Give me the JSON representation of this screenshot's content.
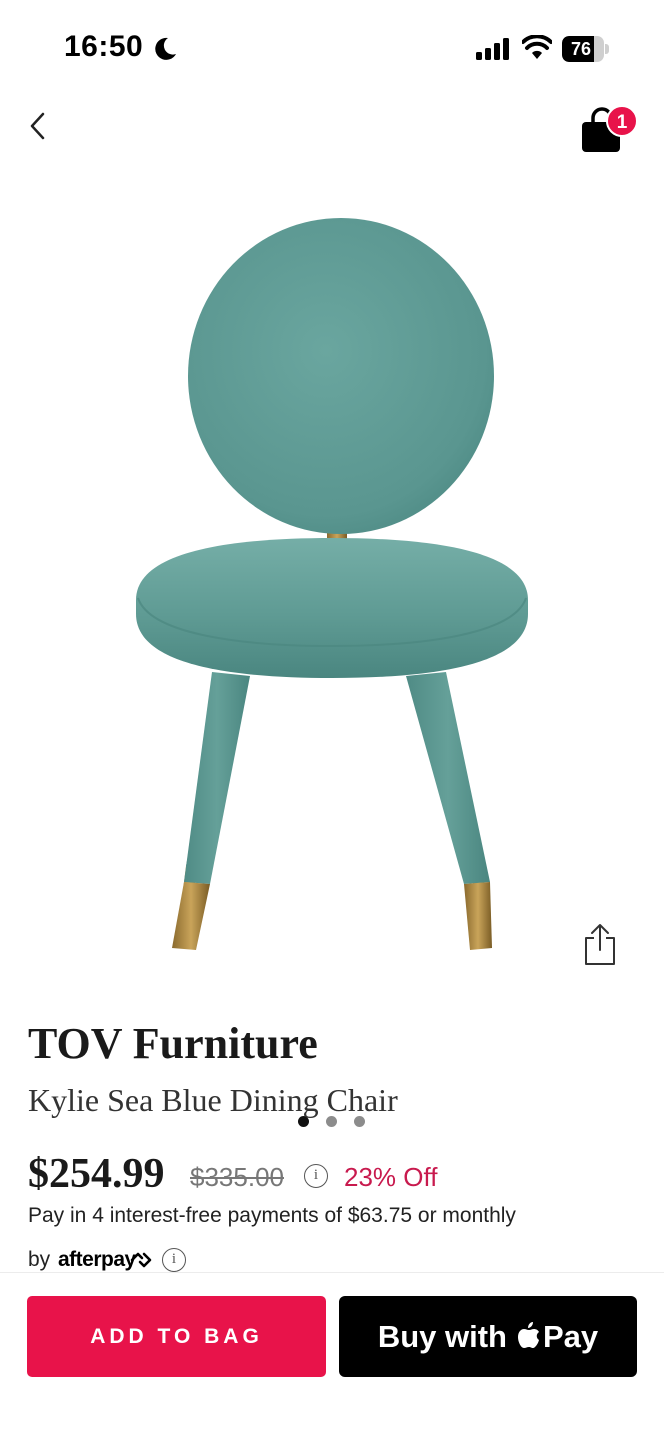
{
  "status_bar": {
    "time": "16:50",
    "battery": "76",
    "battery_level": 0.76,
    "icons": [
      "moon-icon",
      "signal-icon",
      "wifi-icon",
      "battery-icon"
    ]
  },
  "nav": {
    "back_icon": "chevron-left-icon",
    "bag_icon": "shopping-bag-icon",
    "bag_count": "1"
  },
  "gallery": {
    "total_images": 3,
    "active_index": 0,
    "share_icon": "share-icon"
  },
  "product": {
    "brand": "TOV Furniture",
    "name": "Kylie Sea Blue Dining Chair",
    "price": "$254.99",
    "original_price": "$335.00",
    "discount": "23% Off",
    "installments": "Pay in 4 interest-free payments of $63.75 or monthly",
    "afterpay_by": "by",
    "afterpay_brand": "afterpay"
  },
  "actions": {
    "add_to_bag": "ADD TO BAG",
    "buy_with": "Buy with",
    "pay": "Pay"
  },
  "colors": {
    "accent": "#e8134a",
    "discount": "#c81a4e",
    "chair": "#5e9a93"
  }
}
